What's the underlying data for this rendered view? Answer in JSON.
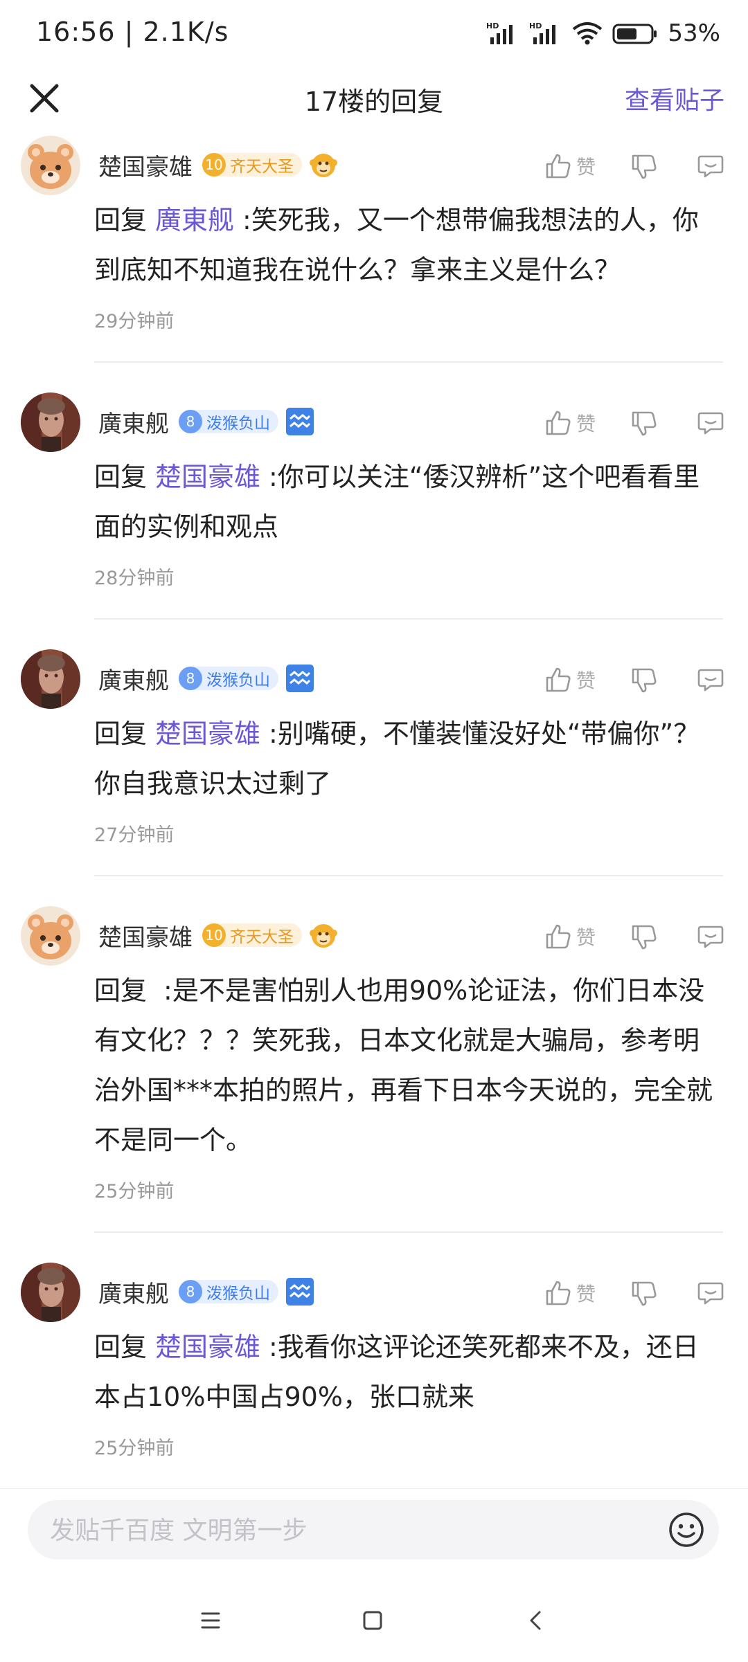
{
  "status_bar": {
    "time_speed": "16:56 | 2.1K/s",
    "battery": "53%",
    "icons": [
      "hd-signal-icon",
      "hd-signal-icon",
      "wifi-icon",
      "battery-icon"
    ]
  },
  "header": {
    "title": "17楼的回复",
    "view_post": "查看贴子",
    "close_icon": "close-icon"
  },
  "colors": {
    "accent": "#6a58d6",
    "time": "#999999",
    "badge_gold": "#f3b02c",
    "badge_blue": "#6b9ef5"
  },
  "replies": [
    {
      "user": "楚国豪雄",
      "level": "10",
      "badge_title": "齐天大圣",
      "badge_style": "gold",
      "deco_icon": "monkey-face-icon",
      "avatar_icon": "bear-avatar",
      "like_label": "赞",
      "prefix": "回复",
      "mention": "廣東舰",
      "content": ":笑死我，又一个想带偏我想法的人，你到底知不知道我在说什么？拿来主义是什么？",
      "time": "29分钟前"
    },
    {
      "user": "廣東舰",
      "level": "8",
      "badge_title": "泼猴负山",
      "badge_style": "blue",
      "deco_icon": "aquarius-icon",
      "avatar_icon": "portrait-avatar",
      "like_label": "赞",
      "prefix": "回复",
      "mention": "楚国豪雄",
      "content": ":你可以关注“倭汉辨析”这个吧看看里面的实例和观点",
      "time": "28分钟前"
    },
    {
      "user": "廣東舰",
      "level": "8",
      "badge_title": "泼猴负山",
      "badge_style": "blue",
      "deco_icon": "aquarius-icon",
      "avatar_icon": "portrait-avatar",
      "like_label": "赞",
      "prefix": "回复",
      "mention": "楚国豪雄",
      "content": ":别嘴硬，不懂装懂没好处“带偏你”？你自我意识太过剩了",
      "time": "27分钟前"
    },
    {
      "user": "楚国豪雄",
      "level": "10",
      "badge_title": "齐天大圣",
      "badge_style": "gold",
      "deco_icon": "monkey-face-icon",
      "avatar_icon": "bear-avatar",
      "like_label": "赞",
      "prefix": "回复",
      "mention": "",
      "content": ":是不是害怕别人也用90%论证法，你们日本没有文化？？？笑死我，日本文化就是大骗局，参考明治外国***本拍的照片，再看下日本今天说的，完全就不是同一个。",
      "time": "25分钟前"
    },
    {
      "user": "廣東舰",
      "level": "8",
      "badge_title": "泼猴负山",
      "badge_style": "blue",
      "deco_icon": "aquarius-icon",
      "avatar_icon": "portrait-avatar",
      "like_label": "赞",
      "prefix": "回复",
      "mention": "楚国豪雄",
      "content": ":我看你这评论还笑死都来不及，还日本占10%中国占90%，张口就来",
      "time": "25分钟前"
    }
  ],
  "composer": {
    "placeholder": "发贴千百度 文明第一步",
    "emoji_icon": "emoji-icon"
  },
  "nav": {
    "icons": [
      "menu-icon",
      "home-square-icon",
      "back-chevron-icon"
    ]
  }
}
